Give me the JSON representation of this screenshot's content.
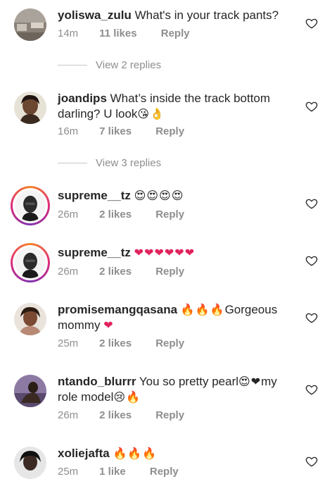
{
  "comments": [
    {
      "username": "yoliswa_zulu",
      "text": "What's in your track pants?",
      "time": "14m",
      "likes": "11 likes",
      "reply": "Reply"
    },
    {
      "username": "joandips",
      "text": "What’s inside the track bottom darling? U look",
      "emoji": "😘👌",
      "time": "16m",
      "likes": "7 likes",
      "reply": "Reply"
    },
    {
      "username": "supreme__tz",
      "text": "",
      "emoji": "😍😍😍😍",
      "time": "26m",
      "likes": "2 likes",
      "reply": "Reply"
    },
    {
      "username": "supreme__tz",
      "text": "",
      "emoji": "❤❤❤❤❤❤",
      "time": "26m",
      "likes": "2 likes",
      "reply": "Reply"
    },
    {
      "username": "promisemangqasana",
      "text_before": "",
      "emoji_a": "🔥🔥🔥",
      "text": "Gorgeous mommy",
      "emoji": "❤",
      "time": "25m",
      "likes": "2 likes",
      "reply": "Reply"
    },
    {
      "username": "ntando_blurrr",
      "text": "You so pretty pearl",
      "emoji_a": "😍❤",
      "text_b": "my role model",
      "emoji": "😢🔥",
      "time": "26m",
      "likes": "2 likes",
      "reply": "Reply"
    },
    {
      "username": "xoliejafta",
      "text": "",
      "emoji": "🔥🔥🔥",
      "time": "25m",
      "likes": "1 like",
      "reply": "Reply"
    }
  ],
  "view_replies": [
    "View 2 replies",
    "View 3 replies"
  ],
  "colors": {
    "text": "#262626",
    "meta": "#8e8e8e",
    "heart": "#262626",
    "emoji_heart": "#e0245e"
  }
}
